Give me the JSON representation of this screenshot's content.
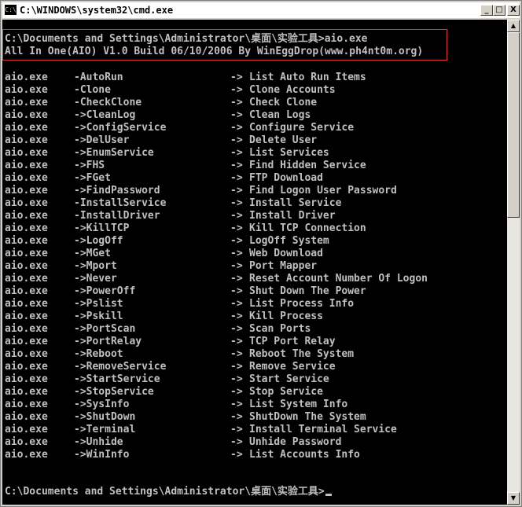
{
  "window": {
    "title": "C:\\WINDOWS\\system32\\cmd.exe",
    "icon_label": "C:\\",
    "minimize_label": "_",
    "maximize_label": "□",
    "close_label": "X"
  },
  "console": {
    "prompt1": "C:\\Documents and Settings\\Administrator\\桌面\\实验工具>aio.exe",
    "banner": "All In One(AIO) V1.0 Build 06/10/2006 By WinEggDrop(www.ph4nt0m.org)",
    "rows": [
      {
        "exe": "aio.exe",
        "option": "-AutoRun",
        "arrow": "->",
        "desc": "List Auto Run Items"
      },
      {
        "exe": "aio.exe",
        "option": "-Clone",
        "arrow": "->",
        "desc": "Clone Accounts"
      },
      {
        "exe": "aio.exe",
        "option": "-CheckClone",
        "arrow": "->",
        "desc": "Check Clone"
      },
      {
        "exe": "aio.exe",
        "option": "->CleanLog",
        "arrow": "->",
        "desc": "Clean Logs"
      },
      {
        "exe": "aio.exe",
        "option": "->ConfigService",
        "arrow": "->",
        "desc": "Configure Service"
      },
      {
        "exe": "aio.exe",
        "option": "->DelUser",
        "arrow": "->",
        "desc": "Delete User"
      },
      {
        "exe": "aio.exe",
        "option": "->EnumService",
        "arrow": "->",
        "desc": "List Services"
      },
      {
        "exe": "aio.exe",
        "option": "->FHS",
        "arrow": "->",
        "desc": "Find Hidden Service"
      },
      {
        "exe": "aio.exe",
        "option": "->FGet",
        "arrow": "->",
        "desc": "FTP Download"
      },
      {
        "exe": "aio.exe",
        "option": "->FindPassword",
        "arrow": "->",
        "desc": "Find Logon User Password"
      },
      {
        "exe": "aio.exe",
        "option": "-InstallService",
        "arrow": "->",
        "desc": "Install Service"
      },
      {
        "exe": "aio.exe",
        "option": "-InstallDriver",
        "arrow": "->",
        "desc": "Install Driver"
      },
      {
        "exe": "aio.exe",
        "option": "->KillTCP",
        "arrow": "->",
        "desc": "Kill TCP Connection"
      },
      {
        "exe": "aio.exe",
        "option": "->LogOff",
        "arrow": "->",
        "desc": "LogOff System"
      },
      {
        "exe": "aio.exe",
        "option": "->MGet",
        "arrow": "->",
        "desc": "Web Download"
      },
      {
        "exe": "aio.exe",
        "option": "->Mport",
        "arrow": "->",
        "desc": "Port Mapper"
      },
      {
        "exe": "aio.exe",
        "option": "->Never",
        "arrow": "->",
        "desc": "Reset Account Number Of Logon"
      },
      {
        "exe": "aio.exe",
        "option": "->PowerOff",
        "arrow": "->",
        "desc": "Shut Down The Power"
      },
      {
        "exe": "aio.exe",
        "option": "->Pslist",
        "arrow": "->",
        "desc": "List Process Info"
      },
      {
        "exe": "aio.exe",
        "option": "->Pskill",
        "arrow": "->",
        "desc": "Kill Process"
      },
      {
        "exe": "aio.exe",
        "option": "->PortScan",
        "arrow": "->",
        "desc": "Scan Ports"
      },
      {
        "exe": "aio.exe",
        "option": "->PortRelay",
        "arrow": "->",
        "desc": "TCP Port Relay"
      },
      {
        "exe": "aio.exe",
        "option": "->Reboot",
        "arrow": "->",
        "desc": "Reboot The System"
      },
      {
        "exe": "aio.exe",
        "option": "->RemoveService",
        "arrow": "->",
        "desc": "Remove Service"
      },
      {
        "exe": "aio.exe",
        "option": "->StartService",
        "arrow": "->",
        "desc": "Start Service"
      },
      {
        "exe": "aio.exe",
        "option": "->StopService",
        "arrow": "->",
        "desc": "Stop Service"
      },
      {
        "exe": "aio.exe",
        "option": "->SysInfo",
        "arrow": "->",
        "desc": "List System Info"
      },
      {
        "exe": "aio.exe",
        "option": "->ShutDown",
        "arrow": "->",
        "desc": "ShutDown The System"
      },
      {
        "exe": "aio.exe",
        "option": "->Terminal",
        "arrow": "->",
        "desc": "Install Terminal Service"
      },
      {
        "exe": "aio.exe",
        "option": "->Unhide",
        "arrow": "->",
        "desc": "Unhide Password"
      },
      {
        "exe": "aio.exe",
        "option": "->WinInfo",
        "arrow": "->",
        "desc": "List Accounts Info"
      }
    ],
    "prompt2": "C:\\Documents and Settings\\Administrator\\桌面\\实验工具>"
  },
  "scrollbar": {
    "up_label": "▲",
    "down_label": "▼"
  },
  "colors": {
    "console_bg": "#000000",
    "console_text": "#c0c0c0",
    "highlight_border": "#e03030"
  }
}
